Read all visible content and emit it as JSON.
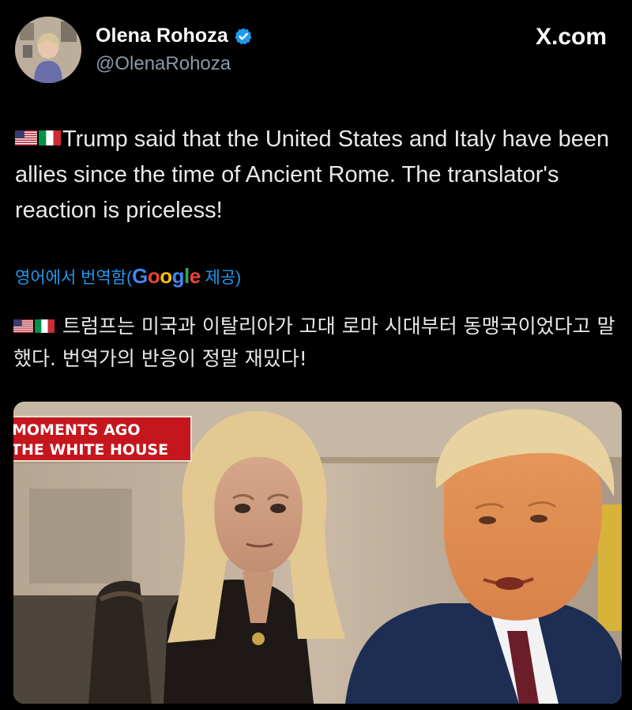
{
  "post": {
    "author": {
      "display_name": "Olena Rohoza",
      "handle": "@OlenaRohoza",
      "verified": true,
      "avatar_icon": "profile-photo-icon"
    },
    "site_label": "X.com",
    "text": {
      "flags": [
        "us-flag-icon",
        "italy-flag-icon"
      ],
      "body": "Trump said that the United States and Italy have been allies since the time of Ancient Rome. The translator's reaction is priceless!"
    },
    "translation": {
      "prefix": "영어에서 번역함(",
      "provider": "Google",
      "suffix": " 제공)",
      "flags": [
        "us-flag-icon",
        "italy-flag-icon"
      ],
      "body": "트럼프는 미국과 이탈리아가 고대 로마 시대부터 동맹국이었다고 말했다. 번역가의 반응이 정말 재밌다!"
    },
    "media": {
      "chyron_line1": "MOMENTS AGO",
      "chyron_line2": "THE WHITE HOUSE",
      "colors": {
        "chyron_red": "#c5161d",
        "suit_navy": "#1e2d52"
      }
    }
  },
  "colors": {
    "background": "#000000",
    "text": "#e7e9ea",
    "secondary_text": "#8b98a5",
    "link_blue": "#1d9bf0",
    "verified_blue": "#1d9bf0"
  }
}
